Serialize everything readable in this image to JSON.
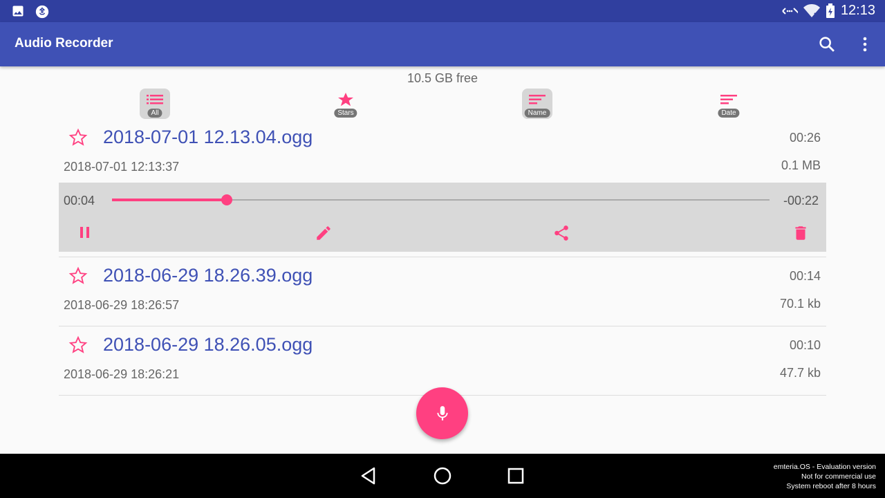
{
  "status_bar": {
    "time": "12:13"
  },
  "app_bar": {
    "title": "Audio Recorder"
  },
  "storage": {
    "free_label": "10.5 GB free"
  },
  "filters": [
    {
      "label": "All",
      "selected": true
    },
    {
      "label": "Stars",
      "selected": false
    },
    {
      "label": "Name",
      "selected": true
    },
    {
      "label": "Date",
      "selected": false
    }
  ],
  "recordings": [
    {
      "name": "2018-07-01 12.13.04.ogg",
      "date": "2018-07-01 12:13:37",
      "duration": "00:26",
      "size": "0.1 MB",
      "starred": false
    },
    {
      "name": "2018-06-29 18.26.39.ogg",
      "date": "2018-06-29 18:26:57",
      "duration": "00:14",
      "size": "70.1 kb",
      "starred": false
    },
    {
      "name": "2018-06-29 18.26.05.ogg",
      "date": "2018-06-29 18:26:21",
      "duration": "00:10",
      "size": "47.7 kb",
      "starred": false
    }
  ],
  "player": {
    "current": "00:04",
    "remaining": "-00:22",
    "progress_percent": 17.5
  },
  "watermark": {
    "line1": "emteria.OS - Evaluation version",
    "line2": "Not for commercial use",
    "line3": "System reboot after 8 hours"
  },
  "colors": {
    "primary": "#3f51b5",
    "primary_dark": "#303f9f",
    "accent": "#ff4081"
  }
}
